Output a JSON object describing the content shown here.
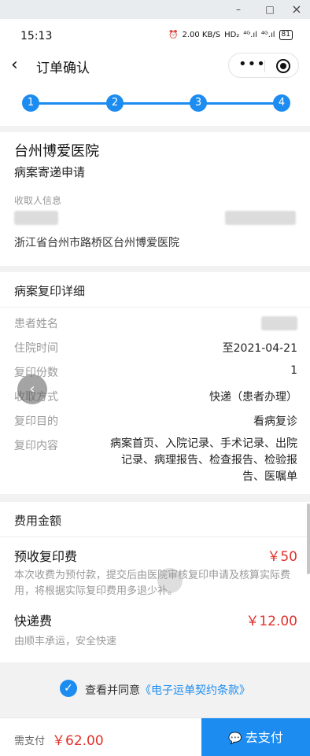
{
  "window": {
    "minimize": "–",
    "maximize": "□",
    "close": "×"
  },
  "status": {
    "time": "15:13",
    "net_speed": "2.00 KB/S",
    "hd": "HD₂",
    "signal1": "⁴ᴳ.ıl",
    "signal2": "⁴ᴳ.ıl",
    "battery": "81"
  },
  "nav": {
    "title": "订单确认",
    "back_icon": "‹",
    "more_icon": "•••"
  },
  "steps": [
    "1",
    "2",
    "3",
    "4"
  ],
  "hospital": {
    "name": "台州博爱医院",
    "service": "病案寄递申请",
    "recipient_label": "收取人信息",
    "address": "浙江省台州市路桥区台州博爱医院"
  },
  "detail": {
    "title": "病案复印详细",
    "rows": [
      {
        "label": "患者姓名",
        "value": ""
      },
      {
        "label": "住院时间",
        "value": "至2021-04-21"
      },
      {
        "label": "复印份数",
        "value": "1"
      },
      {
        "label": "收取方式",
        "value": "快递（患者办理）"
      },
      {
        "label": "复印目的",
        "value": "看病复诊"
      },
      {
        "label": "复印内容",
        "value": "病案首页、入院记录、手术记录、出院记录、病理报告、检查报告、检验报告、医嘱单"
      }
    ]
  },
  "fees": {
    "title": "费用金额",
    "copy_fee_name": "预收复印费",
    "copy_fee_price": "￥50",
    "copy_fee_note": "本次收费为预付款，提交后由医院审核复印申请及核算实际费用，将根据实际复印费用多退少补。",
    "express_fee_name": "快递费",
    "express_fee_price": "￥12.00",
    "express_fee_note": "由顺丰承运，安全快速"
  },
  "agreement": {
    "prefix": "查看并同意",
    "link": "《电子运单契约条款》",
    "check_icon": "✓"
  },
  "pay": {
    "label": "需支付",
    "amount": "￥62.00",
    "button": "去支付",
    "wechat_icon": "●"
  },
  "colors": {
    "primary": "#1c8cf0",
    "price": "#e0312b"
  }
}
